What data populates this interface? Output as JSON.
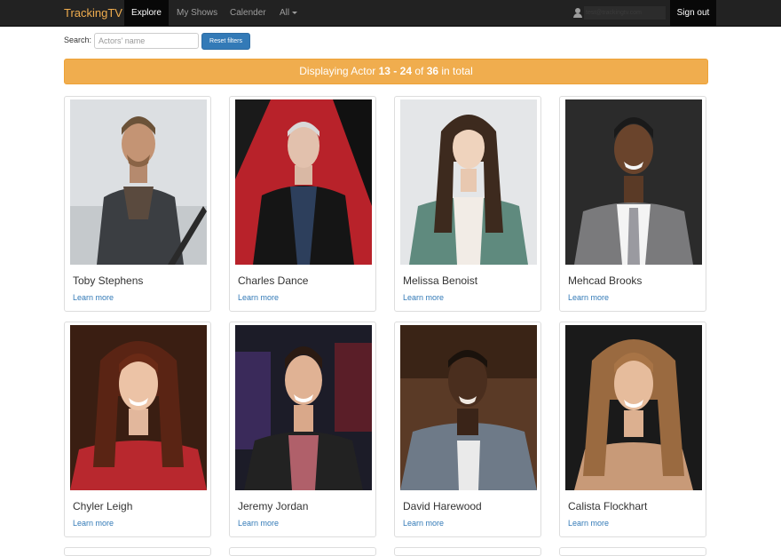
{
  "navbar": {
    "brand": "TrackingTV",
    "items": [
      {
        "label": "Explore",
        "active": true
      },
      {
        "label": "My Shows"
      },
      {
        "label": "Calender"
      },
      {
        "label": "All",
        "dropdown": true
      }
    ],
    "user_icon": "user-icon",
    "user_email": "test@trackingtv.com",
    "sign_out": "Sign out"
  },
  "search": {
    "label": "Search:",
    "placeholder": "Actors' name",
    "reset_label": "Reset filters"
  },
  "banner": {
    "prefix": "Displaying Actor ",
    "range_start": "13",
    "range_sep": " - ",
    "range_end": "24",
    "of_text": " of ",
    "total": "36",
    "suffix": " in total"
  },
  "actors": [
    {
      "name": "Toby Stephens",
      "link": "Learn more"
    },
    {
      "name": "Charles Dance",
      "link": "Learn more"
    },
    {
      "name": "Melissa Benoist",
      "link": "Learn more"
    },
    {
      "name": "Mehcad Brooks",
      "link": "Learn more"
    },
    {
      "name": "Chyler Leigh",
      "link": "Learn more"
    },
    {
      "name": "Jeremy Jordan",
      "link": "Learn more"
    },
    {
      "name": "David Harewood",
      "link": "Learn more"
    },
    {
      "name": "Calista Flockhart",
      "link": "Learn more"
    }
  ],
  "colors": {
    "navbar": "#222222",
    "brand": "#f0ad4e",
    "banner": "#f0ad4e",
    "link": "#337ab7",
    "button": "#337ab7"
  }
}
